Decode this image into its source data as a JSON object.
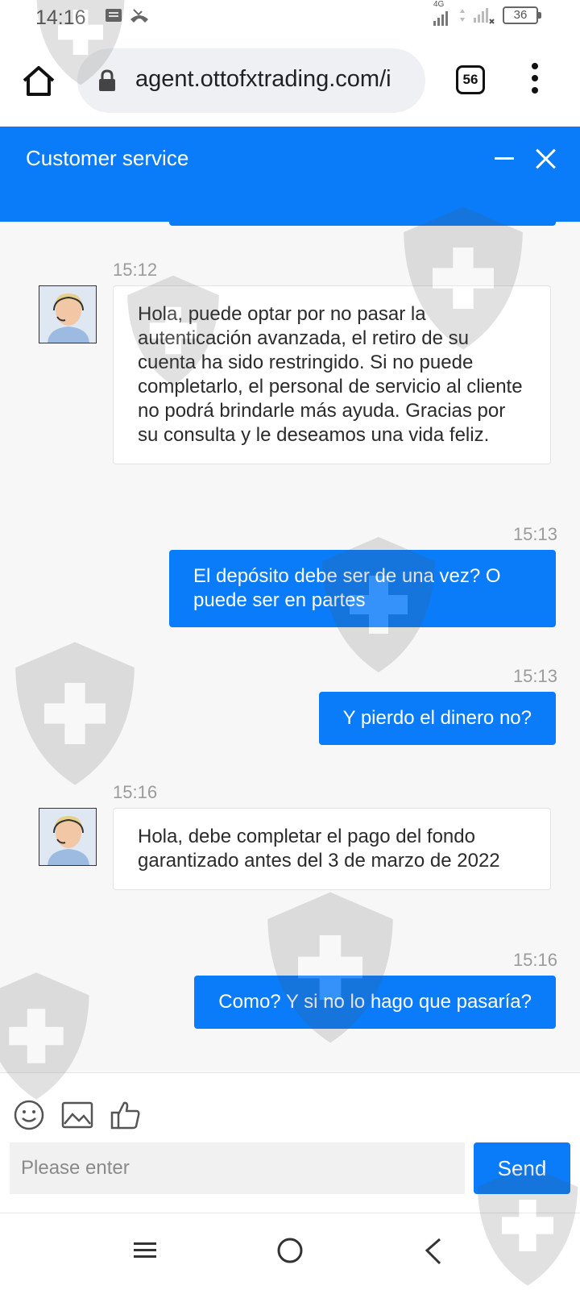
{
  "status_bar": {
    "time": "14:16",
    "network": "4G",
    "battery": "36"
  },
  "browser": {
    "url": "agent.ottofxtrading.com/i",
    "tab_count": "56"
  },
  "chat": {
    "title": "Customer service",
    "messages": [
      {
        "from": "agent",
        "time": "15:12",
        "text": "Hola, puede optar por no pasar la autenticación avanzada, el retiro de su cuenta ha sido restringido. Si no puede completarlo, el personal de servicio al cliente no podrá brindarle más ayuda. Gracias por su consulta y le deseamos una vida feliz."
      },
      {
        "from": "user",
        "time": "15:13",
        "text": "El depósito debe ser de una vez? O puede ser en partes"
      },
      {
        "from": "user",
        "time": "15:13",
        "text": "Y pierdo el dinero no?"
      },
      {
        "from": "agent",
        "time": "15:16",
        "text": "Hola, debe completar el pago del fondo garantizado antes del 3 de marzo de 2022"
      },
      {
        "from": "user",
        "time": "15:16",
        "text": "Como? Y si no lo hago que pasaría?"
      }
    ]
  },
  "composer": {
    "placeholder": "Please enter",
    "send_label": "Send"
  },
  "colors": {
    "accent": "#0a7cf9",
    "bubble_in": "#ffffff",
    "background": "#f7f7f7"
  }
}
